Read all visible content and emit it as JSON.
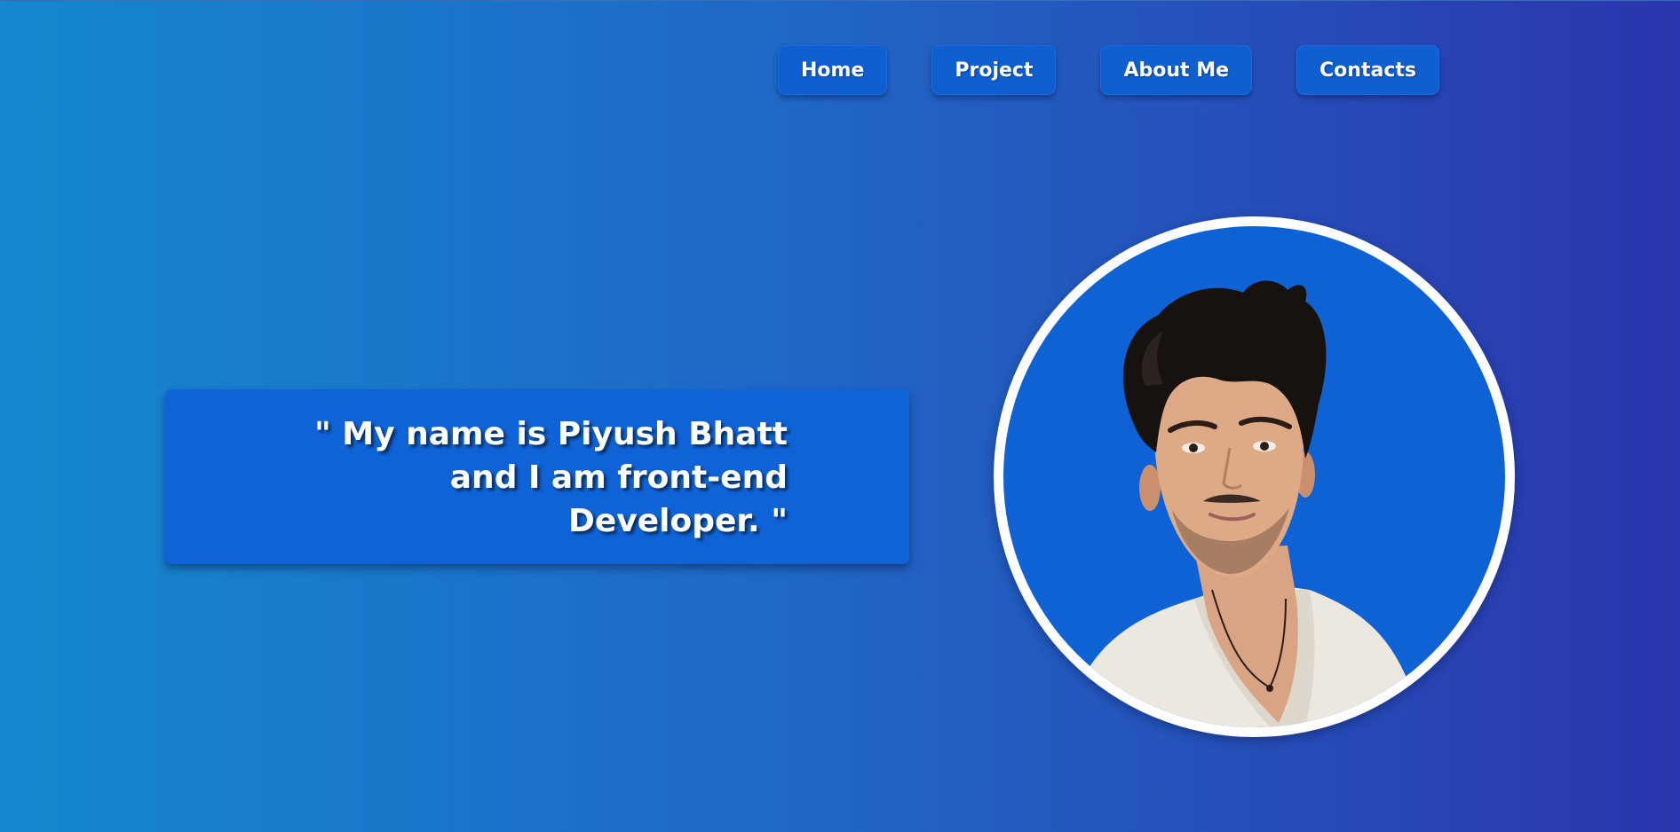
{
  "nav": {
    "items": [
      {
        "label": "Home"
      },
      {
        "label": "Project"
      },
      {
        "label": "About Me"
      },
      {
        "label": "Contacts"
      }
    ]
  },
  "intro": {
    "line1": "\" My name is Piyush Bhatt",
    "line2": "and I am front-end",
    "line3": "Developer. \""
  },
  "colors": {
    "background_left": "#1487cf",
    "background_right": "#2b35ad",
    "button_bg": "#0f5fd1",
    "portrait_bg": "#0f62d4"
  }
}
